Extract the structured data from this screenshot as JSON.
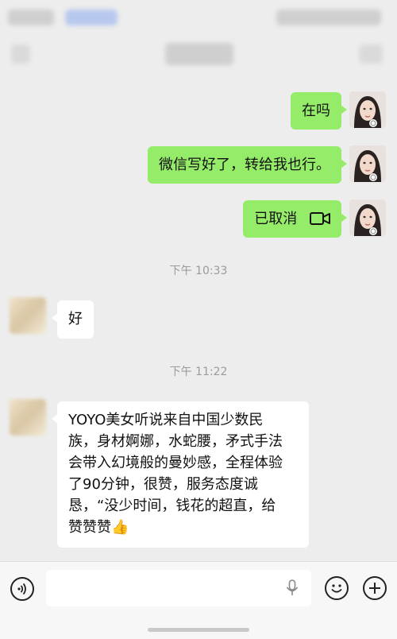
{
  "colors": {
    "background": "#ededed",
    "my_bubble": "#95ec69",
    "their_bubble": "#ffffff",
    "timestamp_text": "#9b9b9b"
  },
  "messages": [
    {
      "side": "right",
      "type": "text",
      "text": "在吗"
    },
    {
      "side": "right",
      "type": "text",
      "text": "微信写好了，转给我也行。"
    },
    {
      "side": "right",
      "type": "video-call",
      "text": "已取消",
      "icon": "video-camera-icon"
    },
    {
      "type": "timestamp",
      "text": "下午 10:33"
    },
    {
      "side": "left",
      "type": "text",
      "text": "好"
    },
    {
      "type": "timestamp",
      "text": "下午 11:22"
    },
    {
      "side": "left",
      "type": "text",
      "lines": [
        "YOYO美女听说来自中国少数民",
        "族，身材婀娜，水蛇腰，矛式手法",
        "会带入幻境般的曼妙感，全程体验",
        "了90分钟，很赞，服务态度诚",
        "恳，“没少时间，钱花的超直，给",
        "赞赞赞👍"
      ]
    }
  ],
  "input_bar": {
    "voice_icon": "voice-toggle-icon",
    "mic_icon": "microphone-icon",
    "emoji_icon": "emoji-icon",
    "more_icon": "plus-icon"
  }
}
